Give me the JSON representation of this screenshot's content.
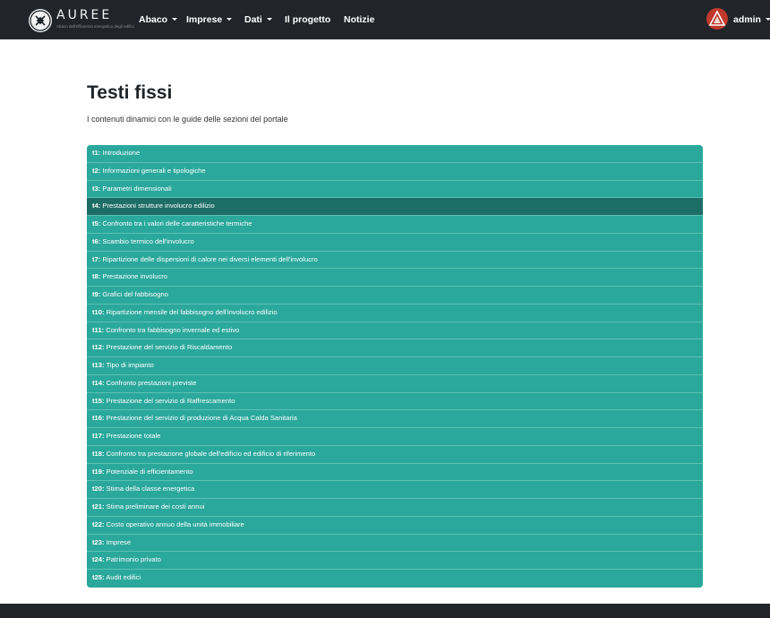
{
  "brand": {
    "name": "AUREE",
    "tagline": "Abaco dell'efficienza energetica degli edifici"
  },
  "nav": {
    "items": [
      {
        "label": "Abaco",
        "dropdown": true
      },
      {
        "label": "Imprese",
        "dropdown": true
      },
      {
        "label": "Dati",
        "dropdown": true
      },
      {
        "label": "Il progetto",
        "dropdown": false
      },
      {
        "label": "Notizie",
        "dropdown": false
      }
    ],
    "user": {
      "name": "admin",
      "dropdown": true
    }
  },
  "page": {
    "title": "Testi fissi",
    "subtitle": "I contenuti dinamici con le guide delle sezioni del portale"
  },
  "colors": {
    "navbar": "#212529",
    "list_item": "#2aa89b",
    "list_item_active": "#1c6e66",
    "avatar": "#c0392b"
  },
  "list": {
    "active_index": 3,
    "items": [
      {
        "code": "t1:",
        "text": " Introduzione"
      },
      {
        "code": "t2:",
        "text": " Informazioni generali e tipologiche"
      },
      {
        "code": "t3:",
        "text": " Parametri dimensionali"
      },
      {
        "code": "t4:",
        "text": " Prestazioni strutture involucro edilizio"
      },
      {
        "code": "t5:",
        "text": " Confronto tra i valori delle caratteristiche termiche"
      },
      {
        "code": "t6:",
        "text": " Scambio termico dell'involucro"
      },
      {
        "code": "t7:",
        "text": " Ripartizione delle dispersioni di calore nei diversi elementi dell'involucro"
      },
      {
        "code": "t8:",
        "text": " Prestazione involucro"
      },
      {
        "code": "t9:",
        "text": " Grafici del fabbisogno"
      },
      {
        "code": "t10:",
        "text": " Ripartizione mensile del fabbisogno dell'involucro edilizio"
      },
      {
        "code": "t11:",
        "text": " Confronto tra fabbisogno invernale ed estivo"
      },
      {
        "code": "t12:",
        "text": " Prestazione del servizio di Riscaldamento"
      },
      {
        "code": "t13:",
        "text": " Tipo di impianto"
      },
      {
        "code": "t14:",
        "text": " Confronto prestazioni previste"
      },
      {
        "code": "t15:",
        "text": " Prestazione del servizio di Raffrescamento"
      },
      {
        "code": "t16:",
        "text": " Prestazione del servizio di produzione di Acqua Calda Sanitaria"
      },
      {
        "code": "t17:",
        "text": " Prestazione totale"
      },
      {
        "code": "t18:",
        "text": " Confronto tra prestazione globale dell'edificio ed edificio di riferimento"
      },
      {
        "code": "t19:",
        "text": " Potenziale di efficientamento"
      },
      {
        "code": "t20:",
        "text": " Stima della classe energetica"
      },
      {
        "code": "t21:",
        "text": " Stima preliminare dei costi annui"
      },
      {
        "code": "t22:",
        "text": " Costo operativo annuo della unità immobiliare"
      },
      {
        "code": "t23:",
        "text": " Imprese"
      },
      {
        "code": "t24:",
        "text": " Patrimonio privato"
      },
      {
        "code": "t25:",
        "text": " Audit edifici"
      }
    ]
  }
}
